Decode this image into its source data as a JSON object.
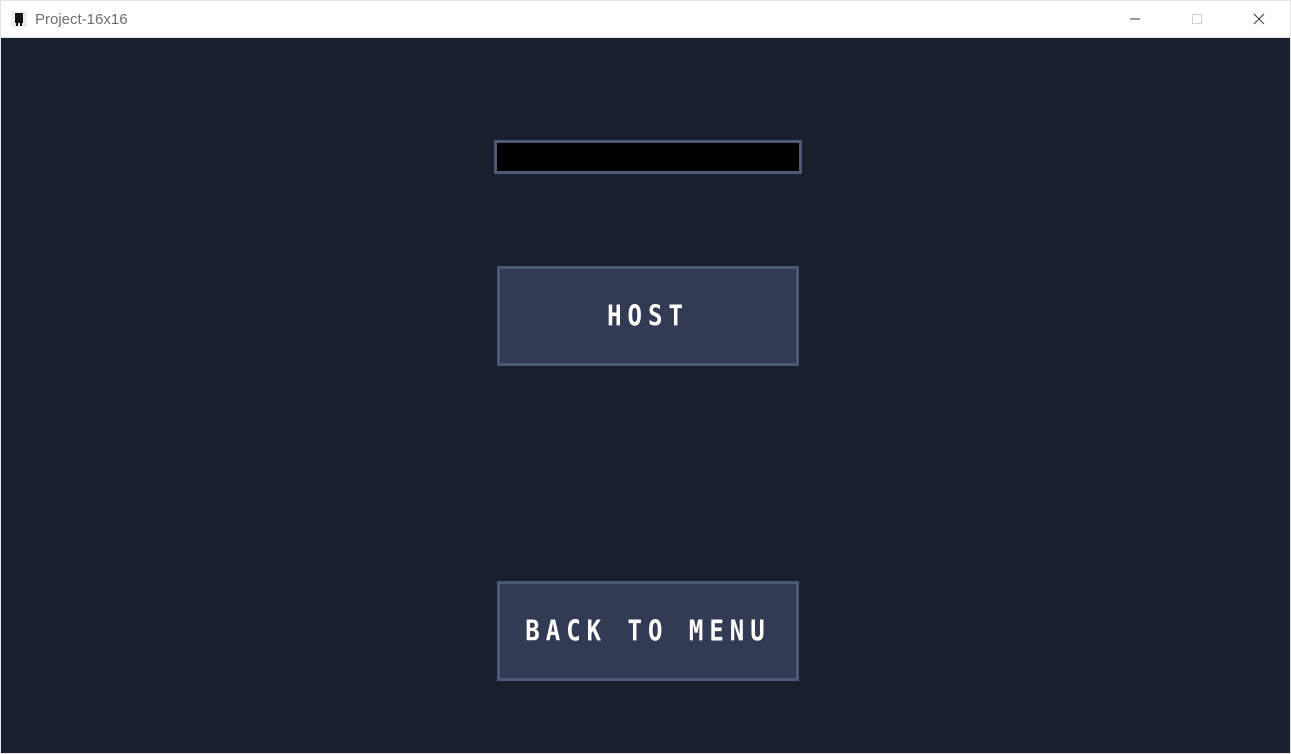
{
  "window": {
    "title": "Project-16x16"
  },
  "menu": {
    "input_value": "",
    "input_placeholder": "",
    "host_label": "HOST",
    "back_label": "BACK TO MENU"
  }
}
